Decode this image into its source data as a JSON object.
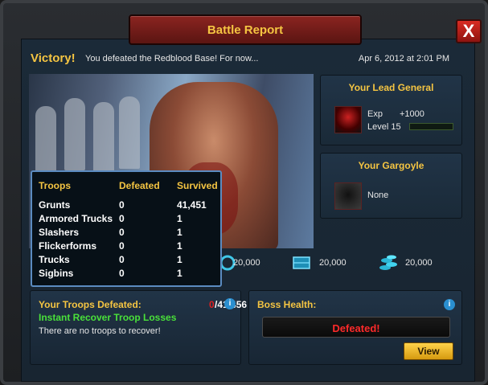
{
  "window": {
    "title": "Battle Report",
    "close_label": "X"
  },
  "header": {
    "victory": "Victory!",
    "message": "You defeated the Redblood Base! For now...",
    "date": "Apr 6, 2012 at 2:01 PM"
  },
  "general": {
    "title": "Your Lead General",
    "exp_label": "Exp",
    "exp_value": "+1000",
    "level": "Level 15",
    "level_progress": 0
  },
  "gargoyle": {
    "title": "Your Gargoyle",
    "value": "None"
  },
  "troops": {
    "headers": [
      "Troops",
      "Defeated",
      "Survived"
    ],
    "rows": [
      [
        "Grunts",
        "0",
        "41,451"
      ],
      [
        "Armored Trucks",
        "0",
        "1"
      ],
      [
        "Slashers",
        "0",
        "1"
      ],
      [
        "Flickerforms",
        "0",
        "1"
      ],
      [
        "Trucks",
        "0",
        "1"
      ],
      [
        "Sigbins",
        "0",
        "1"
      ]
    ]
  },
  "rewards": [
    {
      "icon": "resource-icon",
      "value": "20,000"
    },
    {
      "icon": "crate-icon",
      "value": "20,000"
    },
    {
      "icon": "coins-icon",
      "value": "20,000"
    }
  ],
  "losses": {
    "title": "Your Troops Defeated:",
    "defeated": "0",
    "total": "/41,456",
    "recover_label": "Instant Recover Troop Losses",
    "message": "There are no troops to recover!"
  },
  "boss": {
    "title": "Boss Health:",
    "status": "Defeated!",
    "view_label": "View"
  },
  "colors": {
    "accent": "#f5c542",
    "danger": "#e02020",
    "success": "#49e03a",
    "panel": "#213447"
  }
}
